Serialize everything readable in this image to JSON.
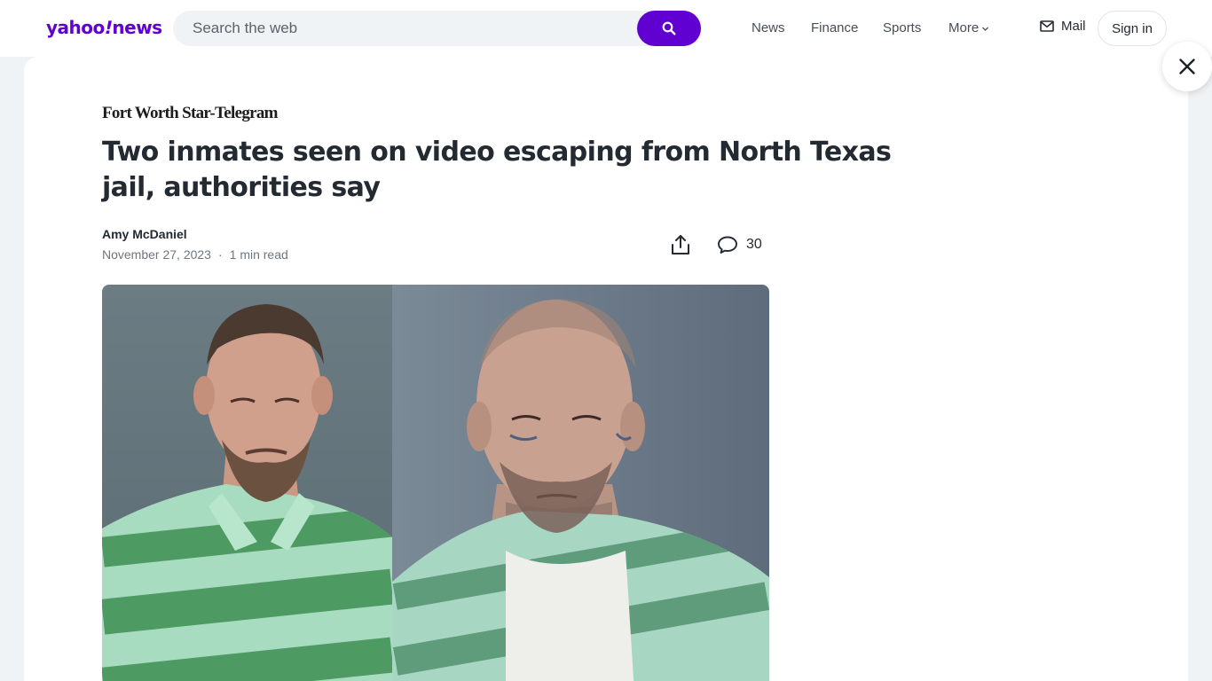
{
  "header": {
    "logo_text_1": "yahoo",
    "logo_text_bang": "!",
    "logo_text_2": "news",
    "search_placeholder": "Search the web",
    "nav": [
      "News",
      "Finance",
      "Sports",
      "More"
    ],
    "mail_label": "Mail",
    "signin_label": "Sign in"
  },
  "article": {
    "publisher": "Fort Worth Star-Telegram",
    "headline": "Two inmates seen on video escaping from North Texas jail, authorities say",
    "author": "Amy McDaniel",
    "date": "November 27, 2023",
    "separator": "·",
    "read_time": "1 min read",
    "comment_count": "30"
  },
  "colors": {
    "brand": "#6001d2",
    "page_bg": "#f0f3f5",
    "text": "#232a31",
    "muted": "#6e7780"
  },
  "icons": [
    "search-icon",
    "chevron-down-icon",
    "mail-icon",
    "close-icon",
    "share-icon",
    "comment-icon"
  ]
}
